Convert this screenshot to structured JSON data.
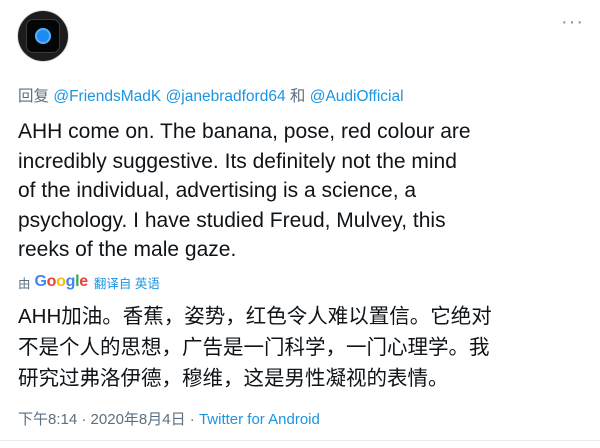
{
  "tweet": {
    "reply_prefix": "回复",
    "reply_to": [
      "@FriendsMadK",
      "@janebradford64",
      "@AudiOfficial"
    ],
    "reply_conjunction": "和",
    "text": "AHH come on. The banana, pose, red colour are\nincredibly suggestive. Its definitely not the mind\nof the individual, advertising is a science, a\npsychology. I have studied Freud, Mulvey, this\nreeks of the male gaze.",
    "translation": {
      "by_label": "由",
      "provider": "Google",
      "action_label": "翻译自 英语",
      "text": "AHH加油。香蕉，姿势，红色令人难以置信。它绝对\n不是个人的思想，广告是一门科学，一门心理学。我\n研究过弗洛伊德，穆维，这是男性凝视的表情。"
    },
    "time": "下午8:14",
    "separator": "·",
    "date": "2020年8月4日",
    "source": "Twitter for Android",
    "more_icon": "more-horizontal-icon"
  }
}
